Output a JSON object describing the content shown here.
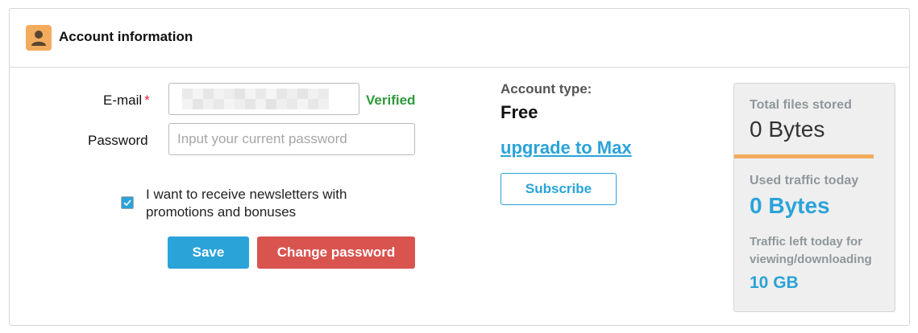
{
  "header": {
    "title": "Account information",
    "icon": "user-icon"
  },
  "form": {
    "email_label": "E-mail",
    "email_required_mark": "*",
    "email_status": "Verified",
    "password_label": "Password",
    "password_placeholder": "Input your current password",
    "password_value": "",
    "newsletter_label": "I want to receive newsletters with promotions and bonuses",
    "newsletter_checked": true,
    "save_label": "Save",
    "change_password_label": "Change password"
  },
  "account": {
    "type_label": "Account type:",
    "type_value": "Free",
    "upgrade_label": "upgrade to Max",
    "subscribe_label": "Subscribe"
  },
  "stats": {
    "total_files_label": "Total files stored",
    "total_files_value": "0 Bytes",
    "used_traffic_label": "Used traffic today",
    "used_traffic_value": "0 Bytes",
    "traffic_left_label": "Traffic left today for viewing/downloading",
    "traffic_left_value": "10 GB"
  },
  "colors": {
    "accent_blue": "#2aa3d9",
    "danger_red": "#d9534f",
    "verified_green": "#2e9a3a",
    "header_icon_orange": "#f3ac5e"
  }
}
